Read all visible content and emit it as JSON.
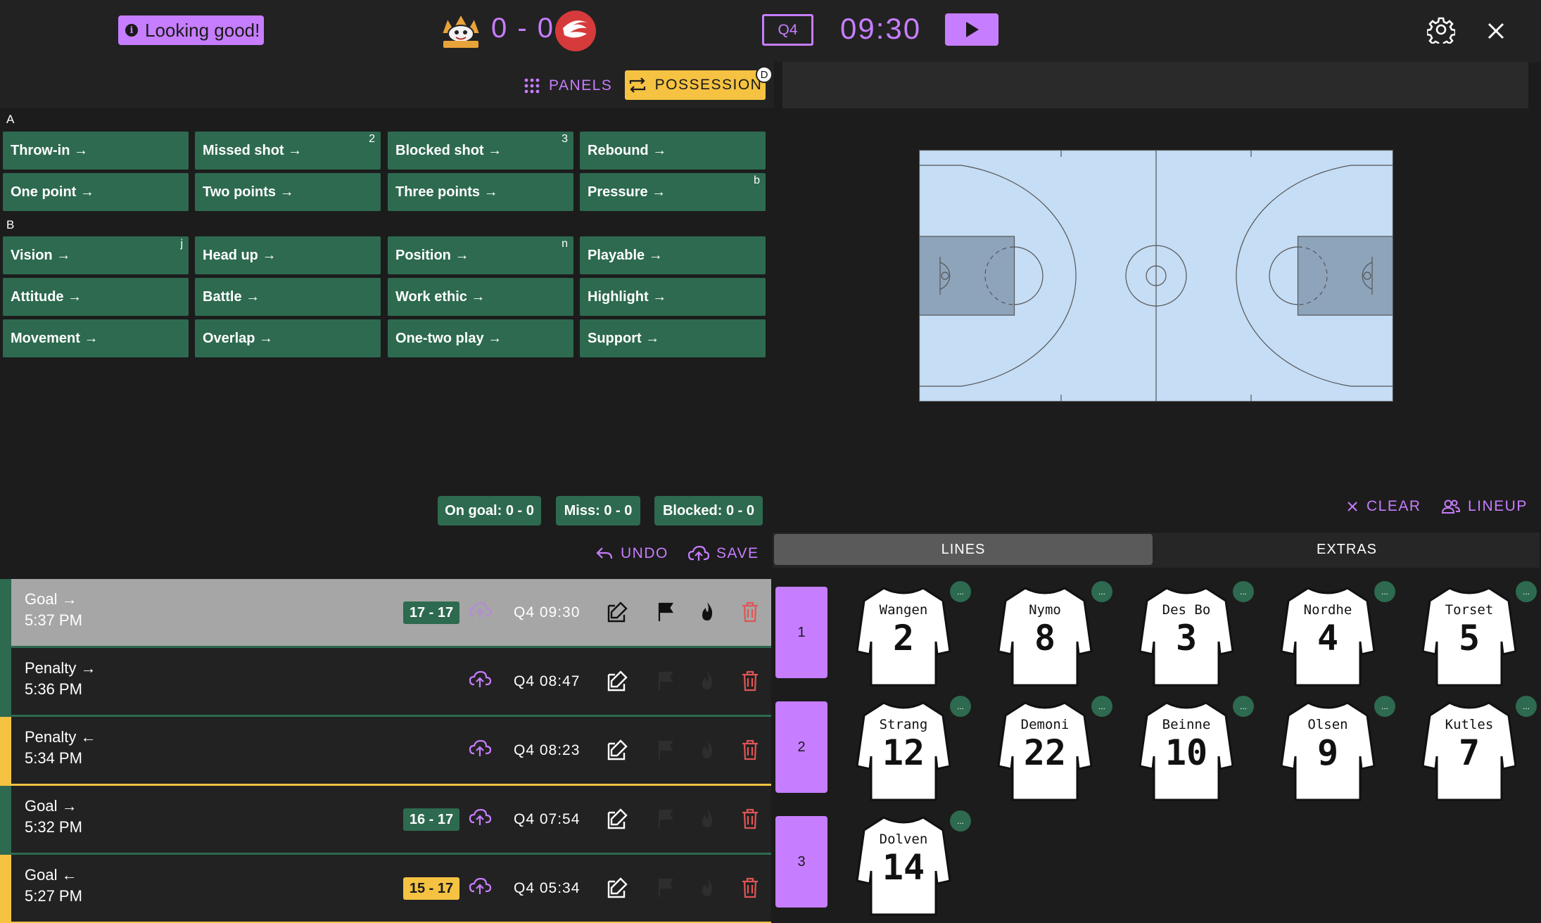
{
  "header": {
    "status": "Looking good!",
    "score": "0 - 0",
    "quarter": "Q4",
    "clock": "09:30"
  },
  "toolbar": {
    "panels_label": "PANELS",
    "possession_label": "POSSESSION",
    "possession_hotkey": "D"
  },
  "groups": {
    "a_label": "A",
    "a_buttons": [
      {
        "label": "Throw-in →",
        "hotkey": ""
      },
      {
        "label": "Missed shot →",
        "hotkey": "2"
      },
      {
        "label": "Blocked shot →",
        "hotkey": "3"
      },
      {
        "label": "Rebound →",
        "hotkey": ""
      },
      {
        "label": "One point →",
        "hotkey": ""
      },
      {
        "label": "Two points →",
        "hotkey": ""
      },
      {
        "label": "Three points →",
        "hotkey": ""
      },
      {
        "label": "Pressure →",
        "hotkey": "b"
      }
    ],
    "b_label": "B",
    "b_buttons": [
      {
        "label": "Vision →",
        "hotkey": "j"
      },
      {
        "label": "Head up →",
        "hotkey": ""
      },
      {
        "label": "Position →",
        "hotkey": "n"
      },
      {
        "label": "Playable →",
        "hotkey": ""
      },
      {
        "label": "Attitude →",
        "hotkey": ""
      },
      {
        "label": "Battle →",
        "hotkey": ""
      },
      {
        "label": "Work ethic →",
        "hotkey": ""
      },
      {
        "label": "Highlight →",
        "hotkey": ""
      },
      {
        "label": "Movement →",
        "hotkey": ""
      },
      {
        "label": "Overlap →",
        "hotkey": ""
      },
      {
        "label": "One-two play →",
        "hotkey": ""
      },
      {
        "label": "Support →",
        "hotkey": ""
      }
    ]
  },
  "stats": {
    "on_goal": "On goal: 0 - 0",
    "miss": "Miss: 0 - 0",
    "blocked": "Blocked: 0 - 0"
  },
  "history_actions": {
    "undo": "UNDO",
    "save": "SAVE"
  },
  "events": [
    {
      "title": "Goal →",
      "time": "5:37 PM",
      "score": "17 - 17",
      "clock": "Q4 09:30",
      "team_color": "#2d6a4f",
      "badge_color": "#2d6a4f",
      "selected": true
    },
    {
      "title": "Penalty →",
      "time": "5:36 PM",
      "score": "",
      "clock": "Q4 08:47",
      "team_color": "#2d6a4f",
      "badge_color": "",
      "selected": false
    },
    {
      "title": "Penalty ←",
      "time": "5:34 PM",
      "score": "",
      "clock": "Q4 08:23",
      "team_color": "#f5c242",
      "badge_color": "",
      "selected": false
    },
    {
      "title": "Goal →",
      "time": "5:32 PM",
      "score": "16 - 17",
      "clock": "Q4 07:54",
      "team_color": "#2d6a4f",
      "badge_color": "#2d6a4f",
      "selected": false
    },
    {
      "title": "Goal ←",
      "time": "5:27 PM",
      "score": "15 - 17",
      "clock": "Q4 05:34",
      "team_color": "#f5c242",
      "badge_color": "#f5c242",
      "selected": false
    }
  ],
  "lineup": {
    "clear_label": "CLEAR",
    "lineup_label": "LINEUP",
    "tabs": [
      "LINES",
      "EXTRAS"
    ],
    "lines": [
      {
        "label": "1",
        "players": [
          {
            "name": "Wangen",
            "number": "2"
          },
          {
            "name": "Nymo",
            "number": "8"
          },
          {
            "name": "Des Bo",
            "number": "3"
          },
          {
            "name": "Nordhe",
            "number": "4"
          },
          {
            "name": "Torset",
            "number": "5"
          }
        ]
      },
      {
        "label": "2",
        "players": [
          {
            "name": "Strang",
            "number": "12"
          },
          {
            "name": "Demoni",
            "number": "22"
          },
          {
            "name": "Beinne",
            "number": "10"
          },
          {
            "name": "Olsen",
            "number": "9"
          },
          {
            "name": "Kutles",
            "number": "7"
          }
        ]
      },
      {
        "label": "3",
        "players": [
          {
            "name": "Dolven",
            "number": "14"
          }
        ]
      }
    ],
    "more_label": "..."
  },
  "colors": {
    "accent": "#c77dff",
    "team_home": "#2d6a4f",
    "team_away": "#f5c242",
    "court": "#c5ddf5"
  }
}
